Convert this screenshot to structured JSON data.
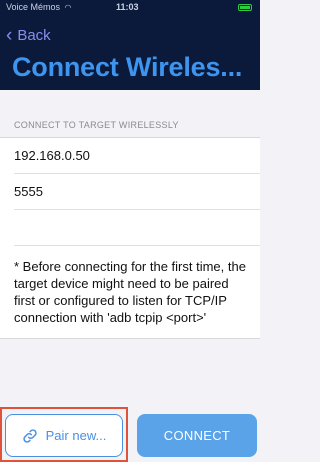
{
  "status_bar": {
    "carrier": "Voice Mémos",
    "time": "11:03"
  },
  "nav": {
    "back_label": "Back",
    "title": "Connect Wireles..."
  },
  "section": {
    "header": "CONNECT TO TARGET WIRELESSLY",
    "ip_value": "192.168.0.50",
    "port_value": "5555",
    "extra_value": "",
    "note": "* Before connecting for the first time, the target device might need to be paired first or configured to listen for TCP/IP connection with 'adb tcpip <port>'"
  },
  "actions": {
    "pair_label": "Pair new...",
    "connect_label": "CONNECT"
  },
  "colors": {
    "header_bg": "#0b1a3a",
    "title": "#3d95f0",
    "accent": "#4a90e2",
    "connect_bg": "#5aa3e8",
    "highlight": "#e0533a"
  },
  "icons": {
    "back": "chevron-left-icon",
    "wifi": "wifi-icon",
    "battery": "battery-icon",
    "pair": "link-icon"
  }
}
